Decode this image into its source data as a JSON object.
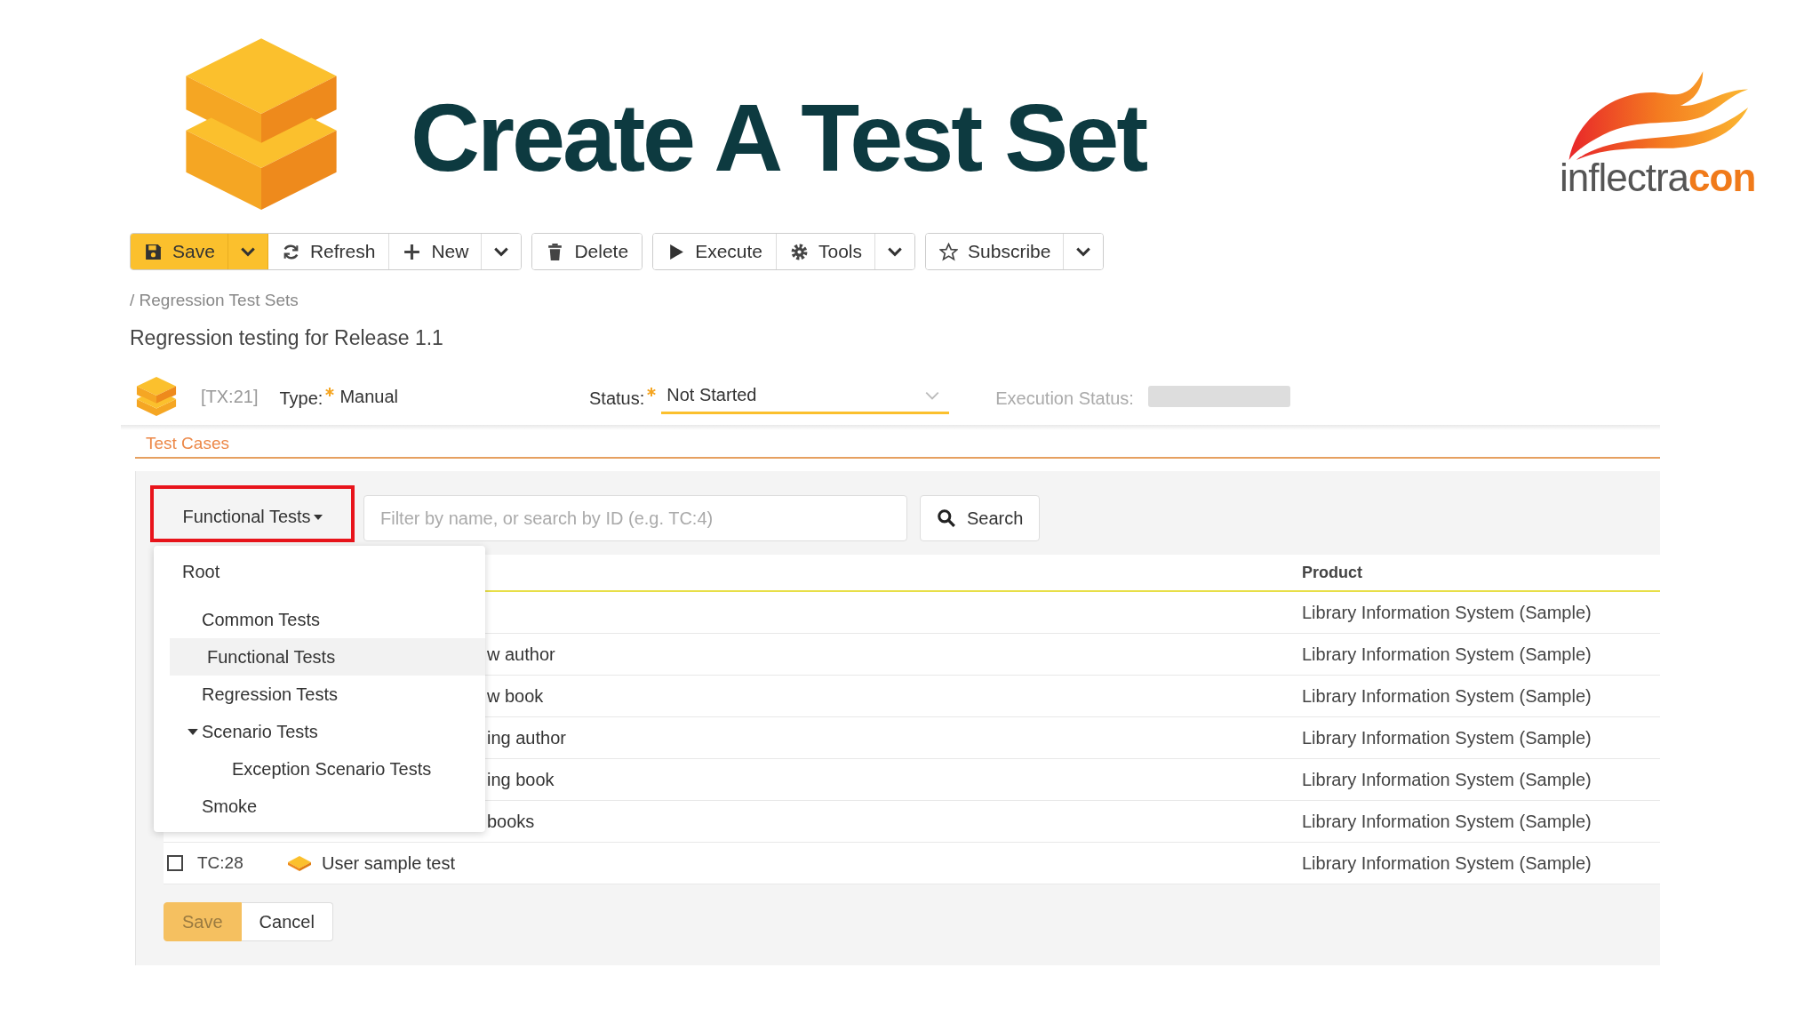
{
  "slide": {
    "title": "Create A Test Set",
    "logo": {
      "wordmark_start": "inflectra",
      "wordmark_end": "con"
    }
  },
  "toolbar": {
    "groups": [
      {
        "buttons": [
          {
            "label": "Save",
            "primary": true,
            "menu": true
          },
          {
            "label": "Refresh",
            "primary": false,
            "menu": false
          },
          {
            "label": "New",
            "primary": false,
            "menu": true
          }
        ]
      },
      {
        "buttons": [
          {
            "label": "Delete",
            "primary": false,
            "menu": false
          }
        ]
      },
      {
        "buttons": [
          {
            "label": "Execute",
            "primary": false,
            "menu": false
          },
          {
            "label": "Tools",
            "primary": false,
            "menu": true
          }
        ]
      },
      {
        "buttons": [
          {
            "label": "Subscribe",
            "primary": false,
            "menu": true
          }
        ]
      }
    ]
  },
  "breadcrumb": "/ Regression Test Sets",
  "title": "Regression testing for Release 1.1",
  "artifact": {
    "id": "[TX:21]",
    "fields": [
      {
        "kind": "text",
        "label": "Type:",
        "required": true,
        "value": "Manual"
      },
      {
        "kind": "dropdown",
        "label": "Status:",
        "required": true,
        "value": "Not Started"
      },
      {
        "kind": "bar",
        "label": "Execution Status:",
        "required": false
      }
    ]
  },
  "tabs": [
    {
      "label": "Test Cases",
      "selected": true
    }
  ],
  "filter": {
    "folder": {
      "label": "Functional Tests",
      "highlighted": true
    },
    "placeholder": "Filter by name, or search by ID (e.g. TC:4)",
    "search": "Search",
    "menu": {
      "items": [
        {
          "label": "Root",
          "selected": false,
          "children": [
            {
              "label": "Common Tests",
              "selected": false
            },
            {
              "label": "Functional Tests",
              "selected": true
            },
            {
              "label": "Regression Tests",
              "selected": false
            },
            {
              "label": "Scenario Tests",
              "selected": false,
              "expanded": true,
              "children": [
                {
                  "label": "Exception Scenario Tests",
                  "selected": false
                }
              ]
            },
            {
              "label": "Smoke",
              "selected": false
            }
          ]
        }
      ]
    }
  },
  "table": {
    "columns": [
      "Product"
    ],
    "rows": [
      {
        "kind": "clipped",
        "product": "Library Information System (Sample)"
      },
      {
        "kind": "clipped",
        "name": "w author",
        "product": "Library Information System (Sample)"
      },
      {
        "kind": "clipped",
        "name": "w book",
        "product": "Library Information System (Sample)"
      },
      {
        "kind": "clipped",
        "name": "ing author",
        "product": "Library Information System (Sample)"
      },
      {
        "kind": "clipped",
        "name": "ing book",
        "product": "Library Information System (Sample)"
      },
      {
        "kind": "clipped",
        "name": "books",
        "product": "Library Information System (Sample)"
      },
      {
        "kind": "full",
        "checked": false,
        "id": "TC:28",
        "name": "User sample test",
        "product": "Library Information System (Sample)"
      }
    ]
  },
  "footer_buttons": [
    {
      "label": "Save",
      "disabled": true
    },
    {
      "label": "Cancel",
      "disabled": false
    }
  ]
}
